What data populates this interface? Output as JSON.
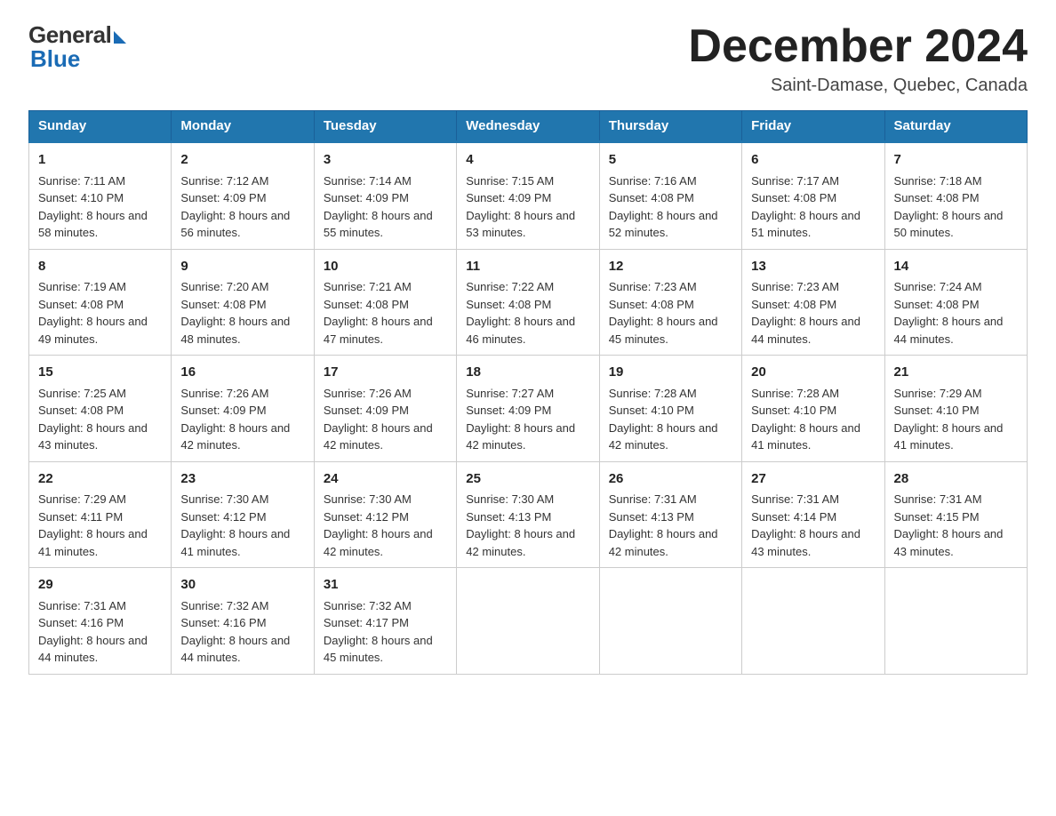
{
  "logo": {
    "general": "General",
    "blue": "Blue"
  },
  "header": {
    "title": "December 2024",
    "location": "Saint-Damase, Quebec, Canada"
  },
  "days_of_week": [
    "Sunday",
    "Monday",
    "Tuesday",
    "Wednesday",
    "Thursday",
    "Friday",
    "Saturday"
  ],
  "weeks": [
    [
      {
        "day": "1",
        "sunrise": "7:11 AM",
        "sunset": "4:10 PM",
        "daylight": "8 hours and 58 minutes."
      },
      {
        "day": "2",
        "sunrise": "7:12 AM",
        "sunset": "4:09 PM",
        "daylight": "8 hours and 56 minutes."
      },
      {
        "day": "3",
        "sunrise": "7:14 AM",
        "sunset": "4:09 PM",
        "daylight": "8 hours and 55 minutes."
      },
      {
        "day": "4",
        "sunrise": "7:15 AM",
        "sunset": "4:09 PM",
        "daylight": "8 hours and 53 minutes."
      },
      {
        "day": "5",
        "sunrise": "7:16 AM",
        "sunset": "4:08 PM",
        "daylight": "8 hours and 52 minutes."
      },
      {
        "day": "6",
        "sunrise": "7:17 AM",
        "sunset": "4:08 PM",
        "daylight": "8 hours and 51 minutes."
      },
      {
        "day": "7",
        "sunrise": "7:18 AM",
        "sunset": "4:08 PM",
        "daylight": "8 hours and 50 minutes."
      }
    ],
    [
      {
        "day": "8",
        "sunrise": "7:19 AM",
        "sunset": "4:08 PM",
        "daylight": "8 hours and 49 minutes."
      },
      {
        "day": "9",
        "sunrise": "7:20 AM",
        "sunset": "4:08 PM",
        "daylight": "8 hours and 48 minutes."
      },
      {
        "day": "10",
        "sunrise": "7:21 AM",
        "sunset": "4:08 PM",
        "daylight": "8 hours and 47 minutes."
      },
      {
        "day": "11",
        "sunrise": "7:22 AM",
        "sunset": "4:08 PM",
        "daylight": "8 hours and 46 minutes."
      },
      {
        "day": "12",
        "sunrise": "7:23 AM",
        "sunset": "4:08 PM",
        "daylight": "8 hours and 45 minutes."
      },
      {
        "day": "13",
        "sunrise": "7:23 AM",
        "sunset": "4:08 PM",
        "daylight": "8 hours and 44 minutes."
      },
      {
        "day": "14",
        "sunrise": "7:24 AM",
        "sunset": "4:08 PM",
        "daylight": "8 hours and 44 minutes."
      }
    ],
    [
      {
        "day": "15",
        "sunrise": "7:25 AM",
        "sunset": "4:08 PM",
        "daylight": "8 hours and 43 minutes."
      },
      {
        "day": "16",
        "sunrise": "7:26 AM",
        "sunset": "4:09 PM",
        "daylight": "8 hours and 42 minutes."
      },
      {
        "day": "17",
        "sunrise": "7:26 AM",
        "sunset": "4:09 PM",
        "daylight": "8 hours and 42 minutes."
      },
      {
        "day": "18",
        "sunrise": "7:27 AM",
        "sunset": "4:09 PM",
        "daylight": "8 hours and 42 minutes."
      },
      {
        "day": "19",
        "sunrise": "7:28 AM",
        "sunset": "4:10 PM",
        "daylight": "8 hours and 42 minutes."
      },
      {
        "day": "20",
        "sunrise": "7:28 AM",
        "sunset": "4:10 PM",
        "daylight": "8 hours and 41 minutes."
      },
      {
        "day": "21",
        "sunrise": "7:29 AM",
        "sunset": "4:10 PM",
        "daylight": "8 hours and 41 minutes."
      }
    ],
    [
      {
        "day": "22",
        "sunrise": "7:29 AM",
        "sunset": "4:11 PM",
        "daylight": "8 hours and 41 minutes."
      },
      {
        "day": "23",
        "sunrise": "7:30 AM",
        "sunset": "4:12 PM",
        "daylight": "8 hours and 41 minutes."
      },
      {
        "day": "24",
        "sunrise": "7:30 AM",
        "sunset": "4:12 PM",
        "daylight": "8 hours and 42 minutes."
      },
      {
        "day": "25",
        "sunrise": "7:30 AM",
        "sunset": "4:13 PM",
        "daylight": "8 hours and 42 minutes."
      },
      {
        "day": "26",
        "sunrise": "7:31 AM",
        "sunset": "4:13 PM",
        "daylight": "8 hours and 42 minutes."
      },
      {
        "day": "27",
        "sunrise": "7:31 AM",
        "sunset": "4:14 PM",
        "daylight": "8 hours and 43 minutes."
      },
      {
        "day": "28",
        "sunrise": "7:31 AM",
        "sunset": "4:15 PM",
        "daylight": "8 hours and 43 minutes."
      }
    ],
    [
      {
        "day": "29",
        "sunrise": "7:31 AM",
        "sunset": "4:16 PM",
        "daylight": "8 hours and 44 minutes."
      },
      {
        "day": "30",
        "sunrise": "7:32 AM",
        "sunset": "4:16 PM",
        "daylight": "8 hours and 44 minutes."
      },
      {
        "day": "31",
        "sunrise": "7:32 AM",
        "sunset": "4:17 PM",
        "daylight": "8 hours and 45 minutes."
      },
      null,
      null,
      null,
      null
    ]
  ],
  "cell_labels": {
    "sunrise": "Sunrise:",
    "sunset": "Sunset:",
    "daylight": "Daylight:"
  }
}
